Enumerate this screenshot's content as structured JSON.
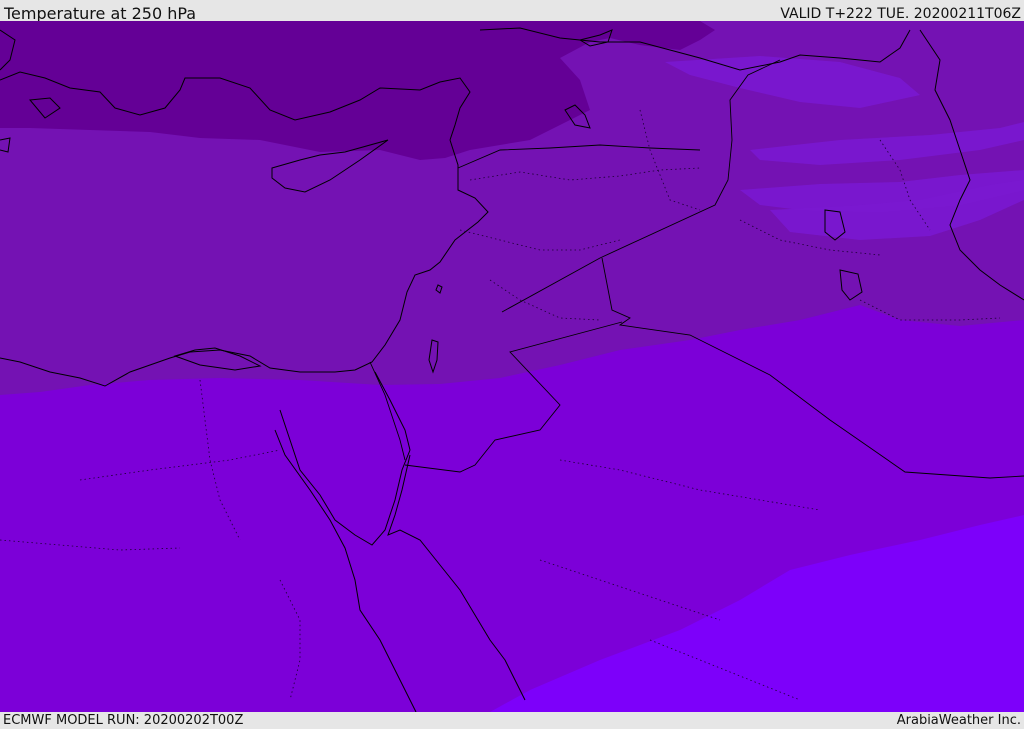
{
  "header": {
    "title": "Temperature at 250 hPa",
    "valid_time": "VALID T+222 TUE. 20200211T06Z"
  },
  "footer": {
    "model_run": "ECMWF MODEL RUN: 20200202T00Z",
    "credit": "ArabiaWeather Inc."
  },
  "colors": {
    "band_coldest": "#640096",
    "band_cold": "#7412b3",
    "band_mid": "#7c00d8",
    "band_warm": "#7d00fa",
    "coastline": "#000000",
    "bar_background": "#e6e6e6"
  }
}
